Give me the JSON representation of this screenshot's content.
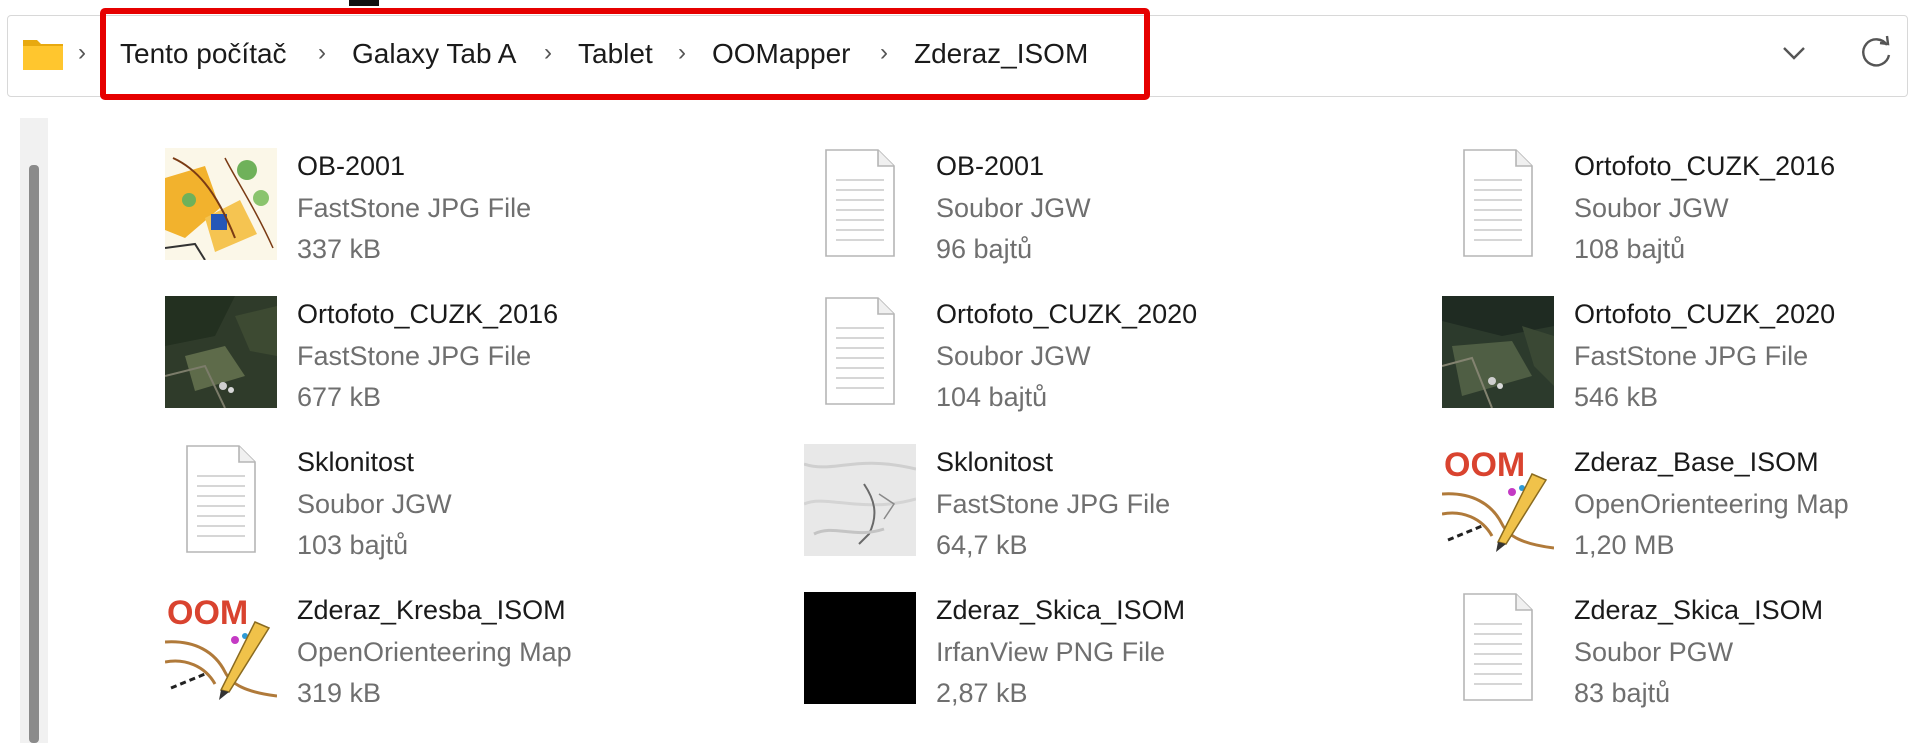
{
  "address_bar": {
    "breadcrumbs": [
      "Tento počítač",
      "Galaxy Tab A",
      "Tablet",
      "OOMapper",
      "Zderaz_ISOM"
    ],
    "separator": "›"
  },
  "highlight_color": "#e60000",
  "files": [
    {
      "name": "OB-2001",
      "type": "FastStone JPG File",
      "size": "337 kB",
      "icon": "map-thumbnail-icon"
    },
    {
      "name": "OB-2001",
      "type": "Soubor JGW",
      "size": "96 bajtů",
      "icon": "document-icon"
    },
    {
      "name": "Ortofoto_CUZK_2016",
      "type": "Soubor JGW",
      "size": "108 bajtů",
      "icon": "document-icon"
    },
    {
      "name": "Ortofoto_CUZK_2016",
      "type": "FastStone JPG File",
      "size": "677 kB",
      "icon": "aerial-photo-thumbnail-icon"
    },
    {
      "name": "Ortofoto_CUZK_2020",
      "type": "Soubor JGW",
      "size": "104 bajtů",
      "icon": "document-icon"
    },
    {
      "name": "Ortofoto_CUZK_2020",
      "type": "FastStone JPG File",
      "size": "546 kB",
      "icon": "aerial-photo-thumbnail-icon"
    },
    {
      "name": "Sklonitost",
      "type": "Soubor JGW",
      "size": "103 bajtů",
      "icon": "document-icon"
    },
    {
      "name": "Sklonitost",
      "type": "FastStone JPG File",
      "size": "64,7 kB",
      "icon": "relief-thumbnail-icon"
    },
    {
      "name": "Zderaz_Base_ISOM",
      "type": "OpenOrienteering Map",
      "size": "1,20 MB",
      "icon": "oom-icon"
    },
    {
      "name": "Zderaz_Kresba_ISOM",
      "type": "OpenOrienteering Map",
      "size": "319 kB",
      "icon": "oom-icon"
    },
    {
      "name": "Zderaz_Skica_ISOM",
      "type": "IrfanView PNG File",
      "size": "2,87 kB",
      "icon": "black-image-thumbnail-icon"
    },
    {
      "name": "Zderaz_Skica_ISOM",
      "type": "Soubor PGW",
      "size": "83 bajtů",
      "icon": "document-icon"
    }
  ]
}
